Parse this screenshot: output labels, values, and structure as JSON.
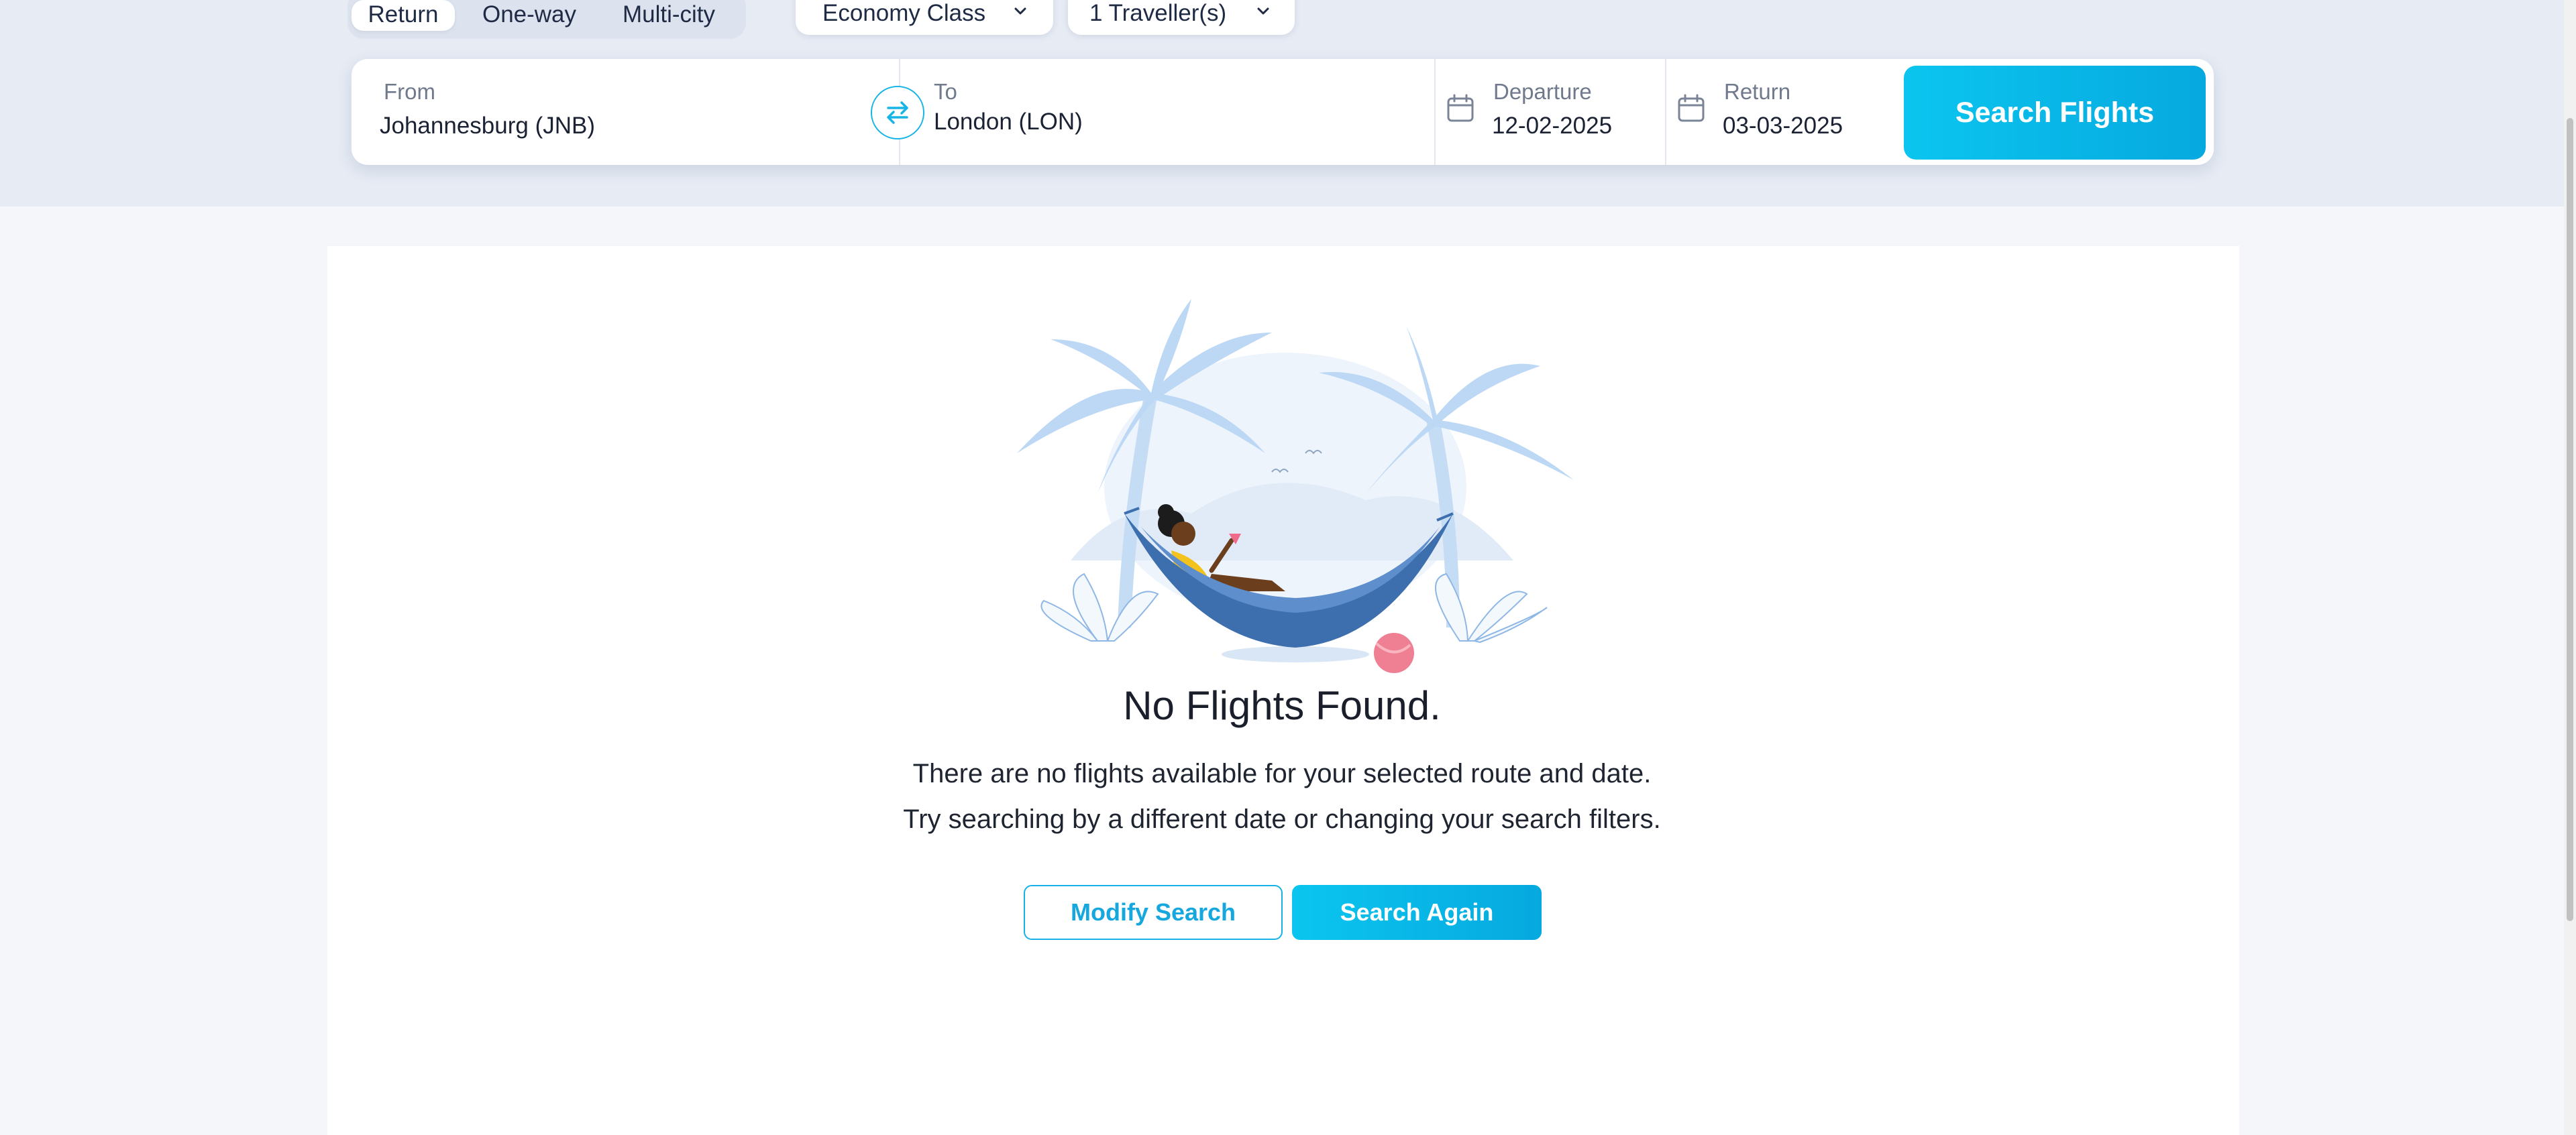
{
  "trip_types": {
    "items": [
      {
        "label": "Return",
        "active": true
      },
      {
        "label": "One-way",
        "active": false
      },
      {
        "label": "Multi-city",
        "active": false
      }
    ]
  },
  "cabin_class": {
    "value": "Economy Class"
  },
  "travellers": {
    "value": "1 Traveller(s)"
  },
  "search": {
    "from": {
      "label": "From",
      "value": "Johannesburg (JNB)"
    },
    "to": {
      "label": "To",
      "value": "London (LON)"
    },
    "departure": {
      "label": "Departure",
      "value": "12-02-2025"
    },
    "return": {
      "label": "Return",
      "value": "03-03-2025"
    },
    "button_label": "Search Flights"
  },
  "results": {
    "title": "No Flights Found.",
    "message_line1": "There are no flights available for your selected route and date.",
    "message_line2": "Try searching by a different date or changing your search filters.",
    "modify_label": "Modify Search",
    "again_label": "Search Again"
  },
  "colors": {
    "accent": "#0bbbe9",
    "band": "#e6ebf4",
    "page": "#f4f6fa",
    "hammock": "#3d6fae"
  },
  "icons": {
    "swap": "swap-arrows-icon",
    "calendar": "calendar-icon",
    "chevron": "chevron-down-icon"
  }
}
